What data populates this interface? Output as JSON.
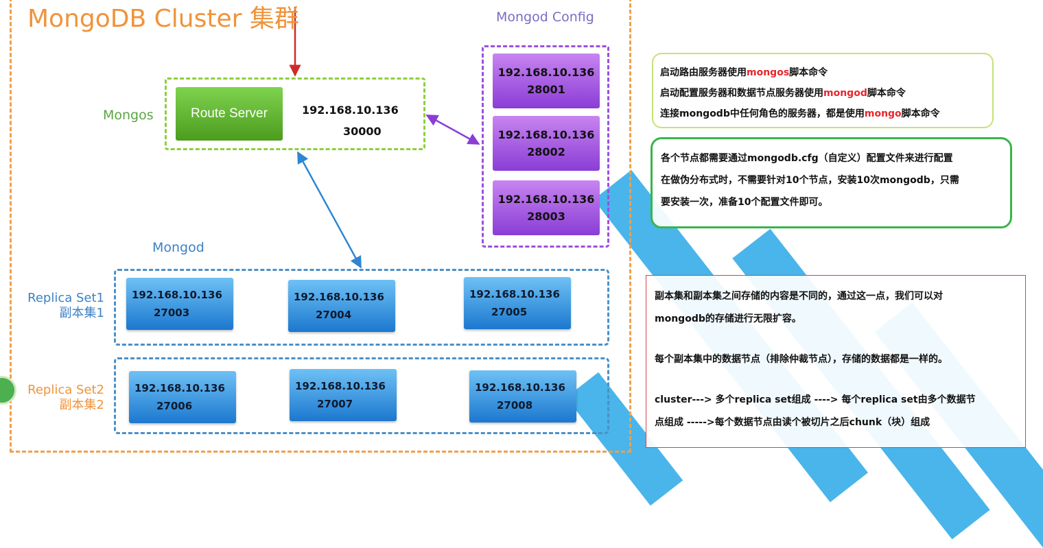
{
  "title": "MongoDB Cluster 集群",
  "config_label": "Mongod Config",
  "mongos_label": "Mongos",
  "mongod_label": "Mongod",
  "route_server": {
    "label": "Route Server",
    "ip": "192.168.10.136",
    "port": "30000"
  },
  "config_nodes": [
    {
      "ip": "192.168.10.136",
      "port": "28001"
    },
    {
      "ip": "192.168.10.136",
      "port": "28002"
    },
    {
      "ip": "192.168.10.136",
      "port": "28003"
    }
  ],
  "replica_sets": [
    {
      "name": "Replica Set1",
      "name_cn": "副本集1",
      "color": "#3b82c4",
      "nodes": [
        {
          "ip": "192.168.10.136",
          "port": "27003"
        },
        {
          "ip": "192.168.10.136",
          "port": "27004"
        },
        {
          "ip": "192.168.10.136",
          "port": "27005"
        }
      ]
    },
    {
      "name": "Replica Set2",
      "name_cn": "副本集2",
      "color": "#f0933a",
      "nodes": [
        {
          "ip": "192.168.10.136",
          "port": "27006"
        },
        {
          "ip": "192.168.10.136",
          "port": "27007"
        },
        {
          "ip": "192.168.10.136",
          "port": "27008"
        }
      ]
    }
  ],
  "note1": {
    "line1_pre": "启动路由服务器使用",
    "line1_kw": "mongos",
    "line1_post": "脚本命令",
    "line2_pre": "启动配置服务器和数据节点服务器使用",
    "line2_kw": "mongod",
    "line2_post": "脚本命令",
    "line3_pre": "连接mongodb中任何角色的服务器，都是使用",
    "line3_kw": "mongo",
    "line3_post": "脚本命令"
  },
  "note2": {
    "line1": "各个节点都需要通过mongodb.cfg（自定义）配置文件来进行配置",
    "line2": "在做伪分布式时，不需要针对10个节点，安装10次mongodb，只需",
    "line3": "要安装一次，准备10个配置文件即可。"
  },
  "note3": {
    "line1": "副本集和副本集之间存储的内容是不同的，通过这一点，我们可以对",
    "line2": "mongodb的存储进行无限扩容。",
    "line3": "每个副本集中的数据节点（排除仲裁节点），存储的数据都是一样的。",
    "line4": "cluster---> 多个replica set组成 ----> 每个replica set由多个数据节",
    "line5": "点组成 ----->每个数据节点由读个被切片之后chunk（块）组成"
  }
}
